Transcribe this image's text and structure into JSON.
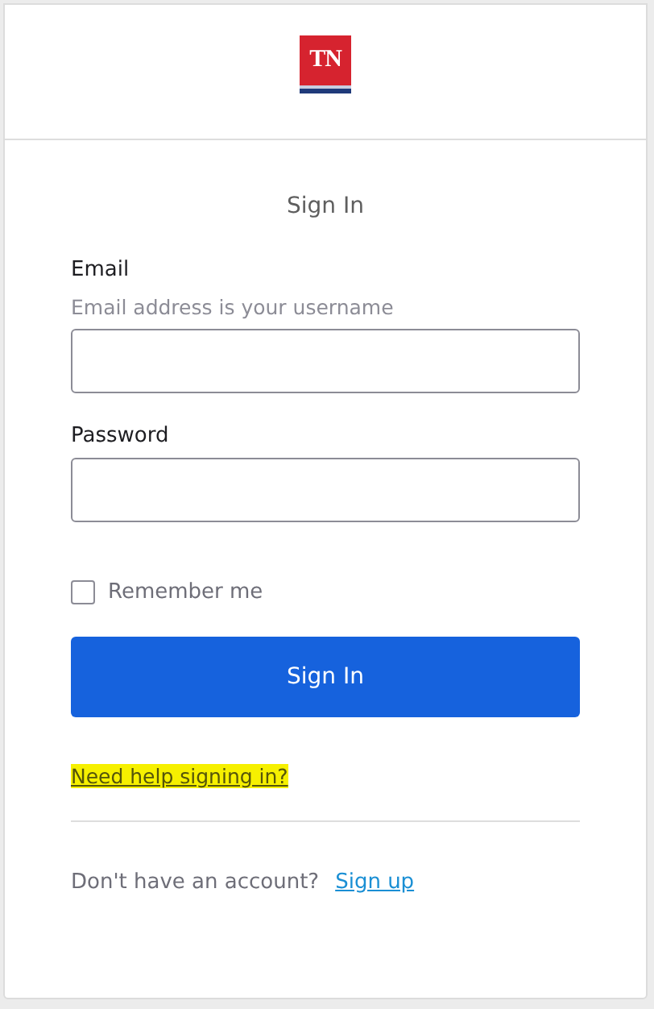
{
  "logo": {
    "text": "TN"
  },
  "title": "Sign In",
  "fields": [
    {
      "label": "Email",
      "hint": "Email address is your username"
    },
    {
      "label": "Password"
    }
  ],
  "remember": {
    "label": "Remember me",
    "checked": false
  },
  "submit": "Sign In",
  "help_link": {
    "text": "Need help signing in?",
    "highlighted": true
  },
  "footer": {
    "text": "Don't have an account?",
    "link": "Sign up"
  }
}
